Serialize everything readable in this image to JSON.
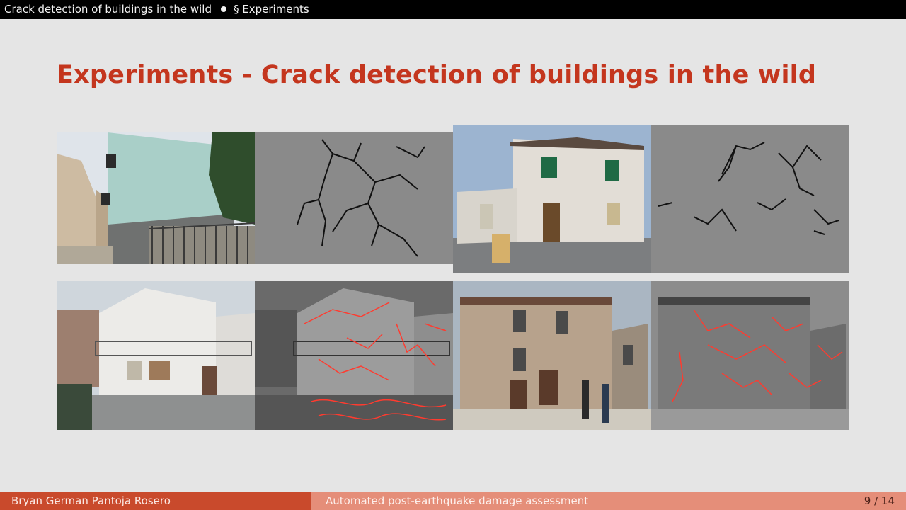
{
  "header": {
    "presentation_title": "Crack detection of buildings in the wild",
    "section": "§ Experiments"
  },
  "slide": {
    "title": "Experiments - Crack detection of buildings in the wild"
  },
  "footer": {
    "author": "Bryan German Pantoja Rosero",
    "talk_title": "Automated post-earthquake damage assessment",
    "page": "9 / 14"
  },
  "colors": {
    "title": "#c4361e",
    "crack_overlay": "#ff3b2f",
    "footer_dark": "#c94a2c",
    "footer_light": "#e58e79"
  }
}
